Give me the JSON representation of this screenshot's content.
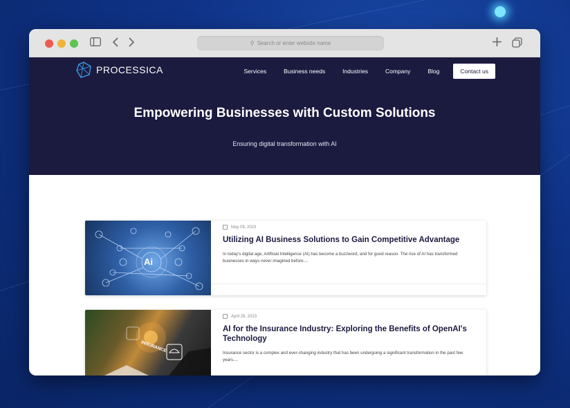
{
  "browser": {
    "address_placeholder": "Search or enter website name"
  },
  "site": {
    "logo_text": "PROCESSICA",
    "nav": [
      "Services",
      "Business needs",
      "Industries",
      "Company",
      "Blog"
    ],
    "cta_label": "Contact us"
  },
  "hero": {
    "title": "Empowering Businesses with Custom Solutions",
    "subtitle": "Ensuring digital transformation with AI"
  },
  "posts": [
    {
      "date": "May 09, 2023",
      "title": "Utilizing AI Business Solutions to Gain Competitive Advantage",
      "excerpt": "In today's digital age, Artificial Intelligence (AI) has become a buzzword, and for good reason. The rise of AI has transformed businesses in ways never imagined before...."
    },
    {
      "date": "April 28, 2023",
      "title": "AI for the Insurance Industry: Exploring the Benefits of OpenAI's Technology",
      "excerpt": "Insurance sector is a complex and ever-changing industry that has been undergoing a significant transformation in the past few years...."
    }
  ],
  "image_text": {
    "ai_badge": "Ai",
    "insurance_badge": "INSURANCE"
  },
  "colors": {
    "hero_bg": "#1b1a3f",
    "page_bg": "#0f3388",
    "accent_glow": "#7fe6ff"
  }
}
